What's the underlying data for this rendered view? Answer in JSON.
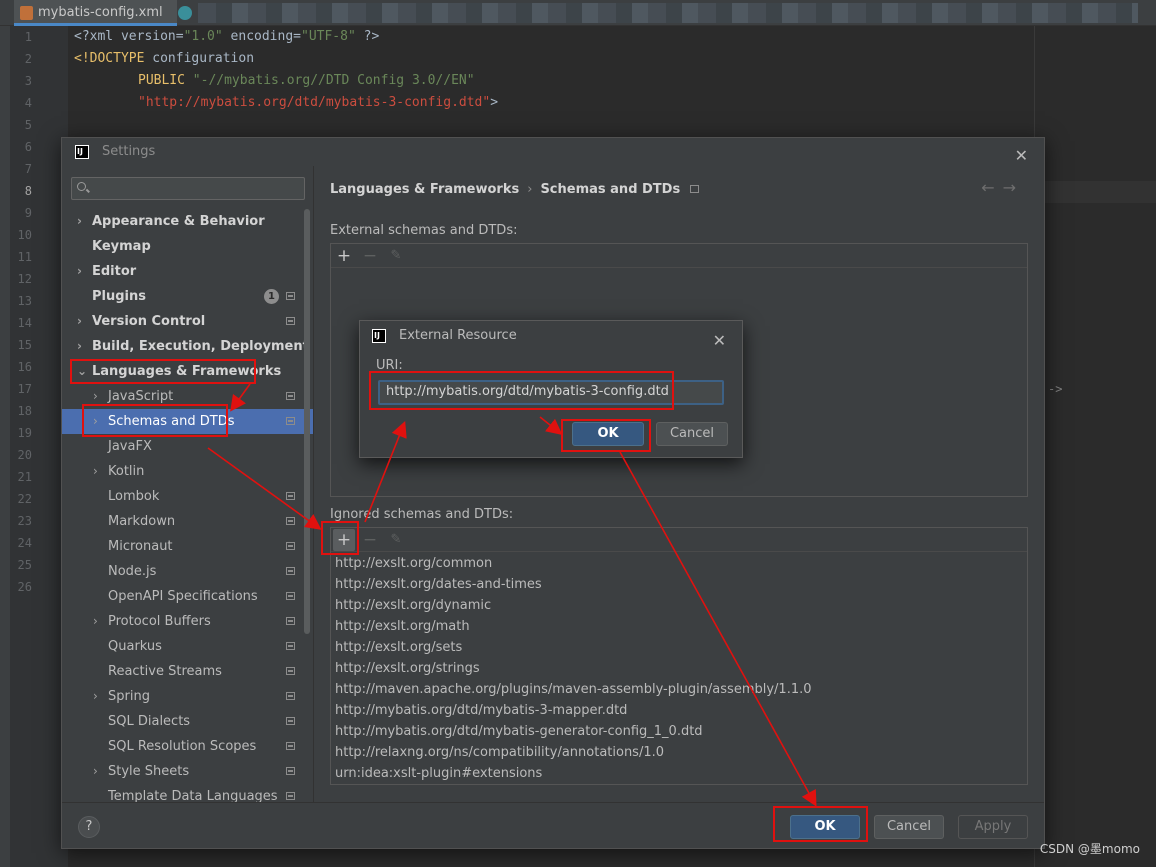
{
  "editor": {
    "tab_title": "mybatis-config.xml",
    "line_numbers": [
      "1",
      "2",
      "3",
      "4",
      "5",
      "6",
      "7",
      "8",
      "9",
      "10",
      "11",
      "12",
      "13",
      "14",
      "15",
      "16",
      "17",
      "18",
      "19",
      "20",
      "21",
      "22",
      "23",
      "24",
      "25",
      "26"
    ],
    "current_line": "8",
    "code": {
      "line1_a": "<?xml version=",
      "line1_b": "\"1.0\"",
      "line1_c": " encoding=",
      "line1_d": "\"UTF-8\"",
      "line1_e": " ?>",
      "line2_a": "<!DOCTYPE",
      "line2_b": " configuration",
      "line3_a": "PUBLIC",
      "line3_b": " \"-//mybatis.org//DTD Config 3.0//EN\"",
      "line4_a": "\"http://mybatis.org/dtd/mybatis-3-config.dtd\"",
      "line4_b": ">"
    },
    "fold_arrow": "->"
  },
  "settings": {
    "title": "Settings",
    "close": "✕",
    "search_placeholder": "",
    "tree": [
      {
        "label": "Appearance & Behavior",
        "chev": "›",
        "bold": true
      },
      {
        "label": "Keymap",
        "chev": "",
        "bold": true
      },
      {
        "label": "Editor",
        "chev": "›",
        "bold": true
      },
      {
        "label": "Plugins",
        "chev": "",
        "bold": true,
        "badge": "1"
      },
      {
        "label": "Version Control",
        "chev": "›",
        "bold": true
      },
      {
        "label": "Build, Execution, Deployment",
        "chev": "›",
        "bold": true
      },
      {
        "label": "Languages & Frameworks",
        "chev": "⌄",
        "bold": true
      },
      {
        "label": "JavaScript",
        "chev": "›"
      },
      {
        "label": "Schemas and DTDs",
        "chev": "›",
        "selected": true
      },
      {
        "label": "JavaFX",
        "chev": ""
      },
      {
        "label": "Kotlin",
        "chev": "›"
      },
      {
        "label": "Lombok",
        "chev": ""
      },
      {
        "label": "Markdown",
        "chev": ""
      },
      {
        "label": "Micronaut",
        "chev": ""
      },
      {
        "label": "Node.js",
        "chev": ""
      },
      {
        "label": "OpenAPI Specifications",
        "chev": ""
      },
      {
        "label": "Protocol Buffers",
        "chev": "›"
      },
      {
        "label": "Quarkus",
        "chev": ""
      },
      {
        "label": "Reactive Streams",
        "chev": ""
      },
      {
        "label": "Spring",
        "chev": "›"
      },
      {
        "label": "SQL Dialects",
        "chev": ""
      },
      {
        "label": "SQL Resolution Scopes",
        "chev": ""
      },
      {
        "label": "Style Sheets",
        "chev": "›"
      },
      {
        "label": "Template Data Languages",
        "chev": ""
      }
    ],
    "breadcrumb": {
      "parent": "Languages & Frameworks",
      "sep": "›",
      "current": "Schemas and DTDs"
    },
    "nav_arrows": "←→",
    "external_label": "External schemas and DTDs:",
    "ignored_label": "Ignored schemas and DTDs:",
    "toolbar": {
      "add": "+",
      "remove": "−",
      "edit": "✎"
    },
    "ignored_items": [
      "http://exslt.org/common",
      "http://exslt.org/dates-and-times",
      "http://exslt.org/dynamic",
      "http://exslt.org/math",
      "http://exslt.org/sets",
      "http://exslt.org/strings",
      "http://maven.apache.org/plugins/maven-assembly-plugin/assembly/1.1.0",
      "http://mybatis.org/dtd/mybatis-3-mapper.dtd",
      "http://mybatis.org/dtd/mybatis-generator-config_1_0.dtd",
      "http://relaxng.org/ns/compatibility/annotations/1.0",
      "urn:idea:xslt-plugin#extensions"
    ],
    "footer": {
      "help": "?",
      "ok": "OK",
      "cancel": "Cancel",
      "apply": "Apply"
    }
  },
  "external_resource": {
    "title": "External Resource",
    "close": "✕",
    "uri_label": "URI:",
    "uri_value": "http://mybatis.org/dtd/mybatis-3-config.dtd",
    "ok": "OK",
    "cancel": "Cancel"
  },
  "watermark": "CSDN @墨momo",
  "colors": {
    "accent": "#4b6eaf",
    "annotation": "#e0110f",
    "default_button": "#365880"
  }
}
